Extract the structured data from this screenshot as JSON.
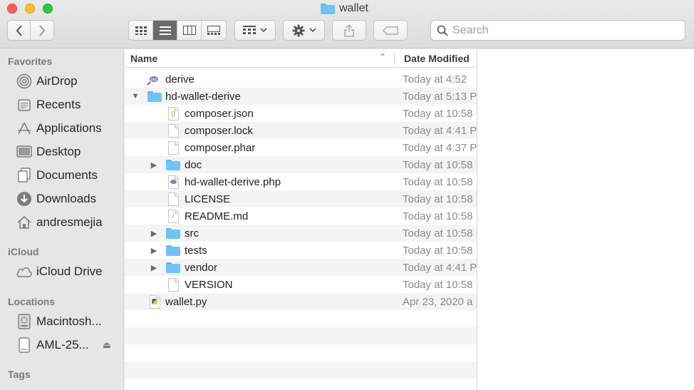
{
  "window": {
    "title": "wallet"
  },
  "toolbar": {
    "back_icon": "chevron-left-icon",
    "forward_icon": "chevron-right-icon",
    "view_modes": [
      "icon-view",
      "list-view",
      "column-view",
      "gallery-view"
    ],
    "active_view": "list-view",
    "search_placeholder": "Search"
  },
  "sidebar": {
    "favorites_label": "Favorites",
    "favorites": [
      {
        "label": "AirDrop",
        "icon": "airdrop-icon"
      },
      {
        "label": "Recents",
        "icon": "recents-icon"
      },
      {
        "label": "Applications",
        "icon": "applications-icon"
      },
      {
        "label": "Desktop",
        "icon": "desktop-icon"
      },
      {
        "label": "Documents",
        "icon": "documents-icon"
      },
      {
        "label": "Downloads",
        "icon": "downloads-icon"
      },
      {
        "label": "andresmejia",
        "icon": "home-icon"
      }
    ],
    "icloud_label": "iCloud",
    "icloud": [
      {
        "label": "iCloud Drive",
        "icon": "cloud-icon"
      }
    ],
    "locations_label": "Locations",
    "locations": [
      {
        "label": "Macintosh...",
        "icon": "hard-drive-icon"
      },
      {
        "label": "AML-25...",
        "icon": "external-drive-icon"
      }
    ],
    "tags_label": "Tags"
  },
  "list": {
    "col_name": "Name",
    "col_date": "Date Modified",
    "rows": [
      {
        "name": "derive",
        "date": "Today at 4:52",
        "kind": "php-exec"
      },
      {
        "name": "hd-wallet-derive",
        "date": "Today at 5:13 P",
        "kind": "folder",
        "expanded": true
      },
      {
        "name": "composer.json",
        "date": "Today at 10:58",
        "kind": "json"
      },
      {
        "name": "composer.lock",
        "date": "Today at 4:41 P",
        "kind": "doc"
      },
      {
        "name": "composer.phar",
        "date": "Today at 4:37 P",
        "kind": "doc"
      },
      {
        "name": "doc",
        "date": "Today at 10:58",
        "kind": "folder"
      },
      {
        "name": "hd-wallet-derive.php",
        "date": "Today at 10:58",
        "kind": "php"
      },
      {
        "name": "LICENSE",
        "date": "Today at 10:58",
        "kind": "doc"
      },
      {
        "name": "README.md",
        "date": "Today at 10:58",
        "kind": "md"
      },
      {
        "name": "src",
        "date": "Today at 10:58",
        "kind": "folder"
      },
      {
        "name": "tests",
        "date": "Today at 10:58",
        "kind": "folder"
      },
      {
        "name": "vendor",
        "date": "Today at 4:41 P",
        "kind": "folder"
      },
      {
        "name": "VERSION",
        "date": "Today at 10:58",
        "kind": "doc"
      },
      {
        "name": "wallet.py",
        "date": "Apr 23, 2020 a",
        "kind": "python"
      }
    ]
  }
}
